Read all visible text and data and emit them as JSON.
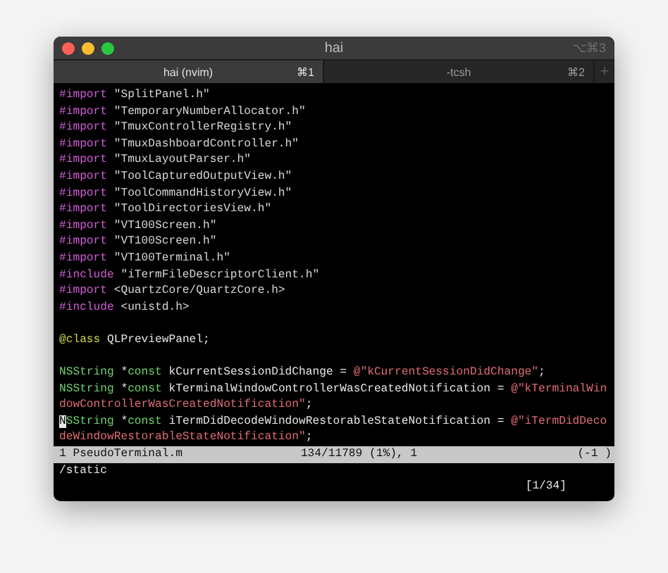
{
  "window": {
    "title": "hai",
    "shortcut": "⌥⌘3"
  },
  "tabs": [
    {
      "label": "hai (nvim)",
      "shortcut": "⌘1",
      "selected": true
    },
    {
      "label": "-tcsh",
      "shortcut": "⌘2",
      "selected": false
    }
  ],
  "new_tab_button": "+",
  "editor": {
    "lines": [
      {
        "segments": [
          {
            "kind": "preproc",
            "text": "#import"
          },
          {
            "kind": "header",
            "text": " \"SplitPanel.h\""
          }
        ]
      },
      {
        "segments": [
          {
            "kind": "preproc",
            "text": "#import"
          },
          {
            "kind": "header",
            "text": " \"TemporaryNumberAllocator.h\""
          }
        ]
      },
      {
        "segments": [
          {
            "kind": "preproc",
            "text": "#import"
          },
          {
            "kind": "header",
            "text": " \"TmuxControllerRegistry.h\""
          }
        ]
      },
      {
        "segments": [
          {
            "kind": "preproc",
            "text": "#import"
          },
          {
            "kind": "header",
            "text": " \"TmuxDashboardController.h\""
          }
        ]
      },
      {
        "segments": [
          {
            "kind": "preproc",
            "text": "#import"
          },
          {
            "kind": "header",
            "text": " \"TmuxLayoutParser.h\""
          }
        ]
      },
      {
        "segments": [
          {
            "kind": "preproc",
            "text": "#import"
          },
          {
            "kind": "header",
            "text": " \"ToolCapturedOutputView.h\""
          }
        ]
      },
      {
        "segments": [
          {
            "kind": "preproc",
            "text": "#import"
          },
          {
            "kind": "header",
            "text": " \"ToolCommandHistoryView.h\""
          }
        ]
      },
      {
        "segments": [
          {
            "kind": "preproc",
            "text": "#import"
          },
          {
            "kind": "header",
            "text": " \"ToolDirectoriesView.h\""
          }
        ]
      },
      {
        "segments": [
          {
            "kind": "preproc",
            "text": "#import"
          },
          {
            "kind": "header",
            "text": " \"VT100Screen.h\""
          }
        ]
      },
      {
        "segments": [
          {
            "kind": "preproc",
            "text": "#import"
          },
          {
            "kind": "header",
            "text": " \"VT100Screen.h\""
          }
        ]
      },
      {
        "segments": [
          {
            "kind": "preproc",
            "text": "#import"
          },
          {
            "kind": "header",
            "text": " \"VT100Terminal.h\""
          }
        ]
      },
      {
        "segments": [
          {
            "kind": "preproc",
            "text": "#include"
          },
          {
            "kind": "header",
            "text": " \"iTermFileDescriptorClient.h\""
          }
        ]
      },
      {
        "segments": [
          {
            "kind": "preproc",
            "text": "#import"
          },
          {
            "kind": "header",
            "text": " <QuartzCore/QuartzCore.h>"
          }
        ]
      },
      {
        "segments": [
          {
            "kind": "preproc",
            "text": "#include"
          },
          {
            "kind": "header",
            "text": " <unistd.h>"
          }
        ],
        "blank_after": true
      },
      {
        "segments": [
          {
            "kind": "keyword",
            "text": "@class"
          },
          {
            "kind": "plain",
            "text": " QLPreviewPanel;"
          }
        ],
        "blank_after": true
      },
      {
        "segments": [
          {
            "kind": "type",
            "text": "NSString"
          },
          {
            "kind": "plain",
            "text": " *"
          },
          {
            "kind": "type",
            "text": "const"
          },
          {
            "kind": "plain",
            "text": " kCurrentSessionDidChange = "
          },
          {
            "kind": "string",
            "text": "@\"kCurrentSessionDidChange\""
          },
          {
            "kind": "plain",
            "text": ";"
          }
        ]
      },
      {
        "segments": [
          {
            "kind": "type",
            "text": "NSString"
          },
          {
            "kind": "plain",
            "text": " *"
          },
          {
            "kind": "type",
            "text": "const"
          },
          {
            "kind": "plain",
            "text": " kTerminalWindowControllerWasCreatedNotification = "
          },
          {
            "kind": "string",
            "text": "@\"kTerminalWin"
          }
        ]
      },
      {
        "segments": [
          {
            "kind": "string",
            "text": "dowControllerWasCreatedNotification\""
          },
          {
            "kind": "plain",
            "text": ";"
          }
        ]
      },
      {
        "segments": [
          {
            "kind": "cursor",
            "text": "N"
          },
          {
            "kind": "type",
            "text": "SString"
          },
          {
            "kind": "plain",
            "text": " *"
          },
          {
            "kind": "type",
            "text": "const"
          },
          {
            "kind": "plain",
            "text": " iTermDidDecodeWindowRestorableStateNotification = "
          },
          {
            "kind": "string",
            "text": "@\"iTermDidDeco"
          }
        ]
      },
      {
        "segments": [
          {
            "kind": "string",
            "text": "deWindowRestorableStateNotification\""
          },
          {
            "kind": "plain",
            "text": ";"
          }
        ]
      }
    ],
    "status_line": {
      "file": "1 PseudoTerminal.m",
      "position": "134/11789 (1%), 1",
      "column_3": "(-1 )"
    },
    "command_line": "/static",
    "search_count": "[1/34]"
  }
}
